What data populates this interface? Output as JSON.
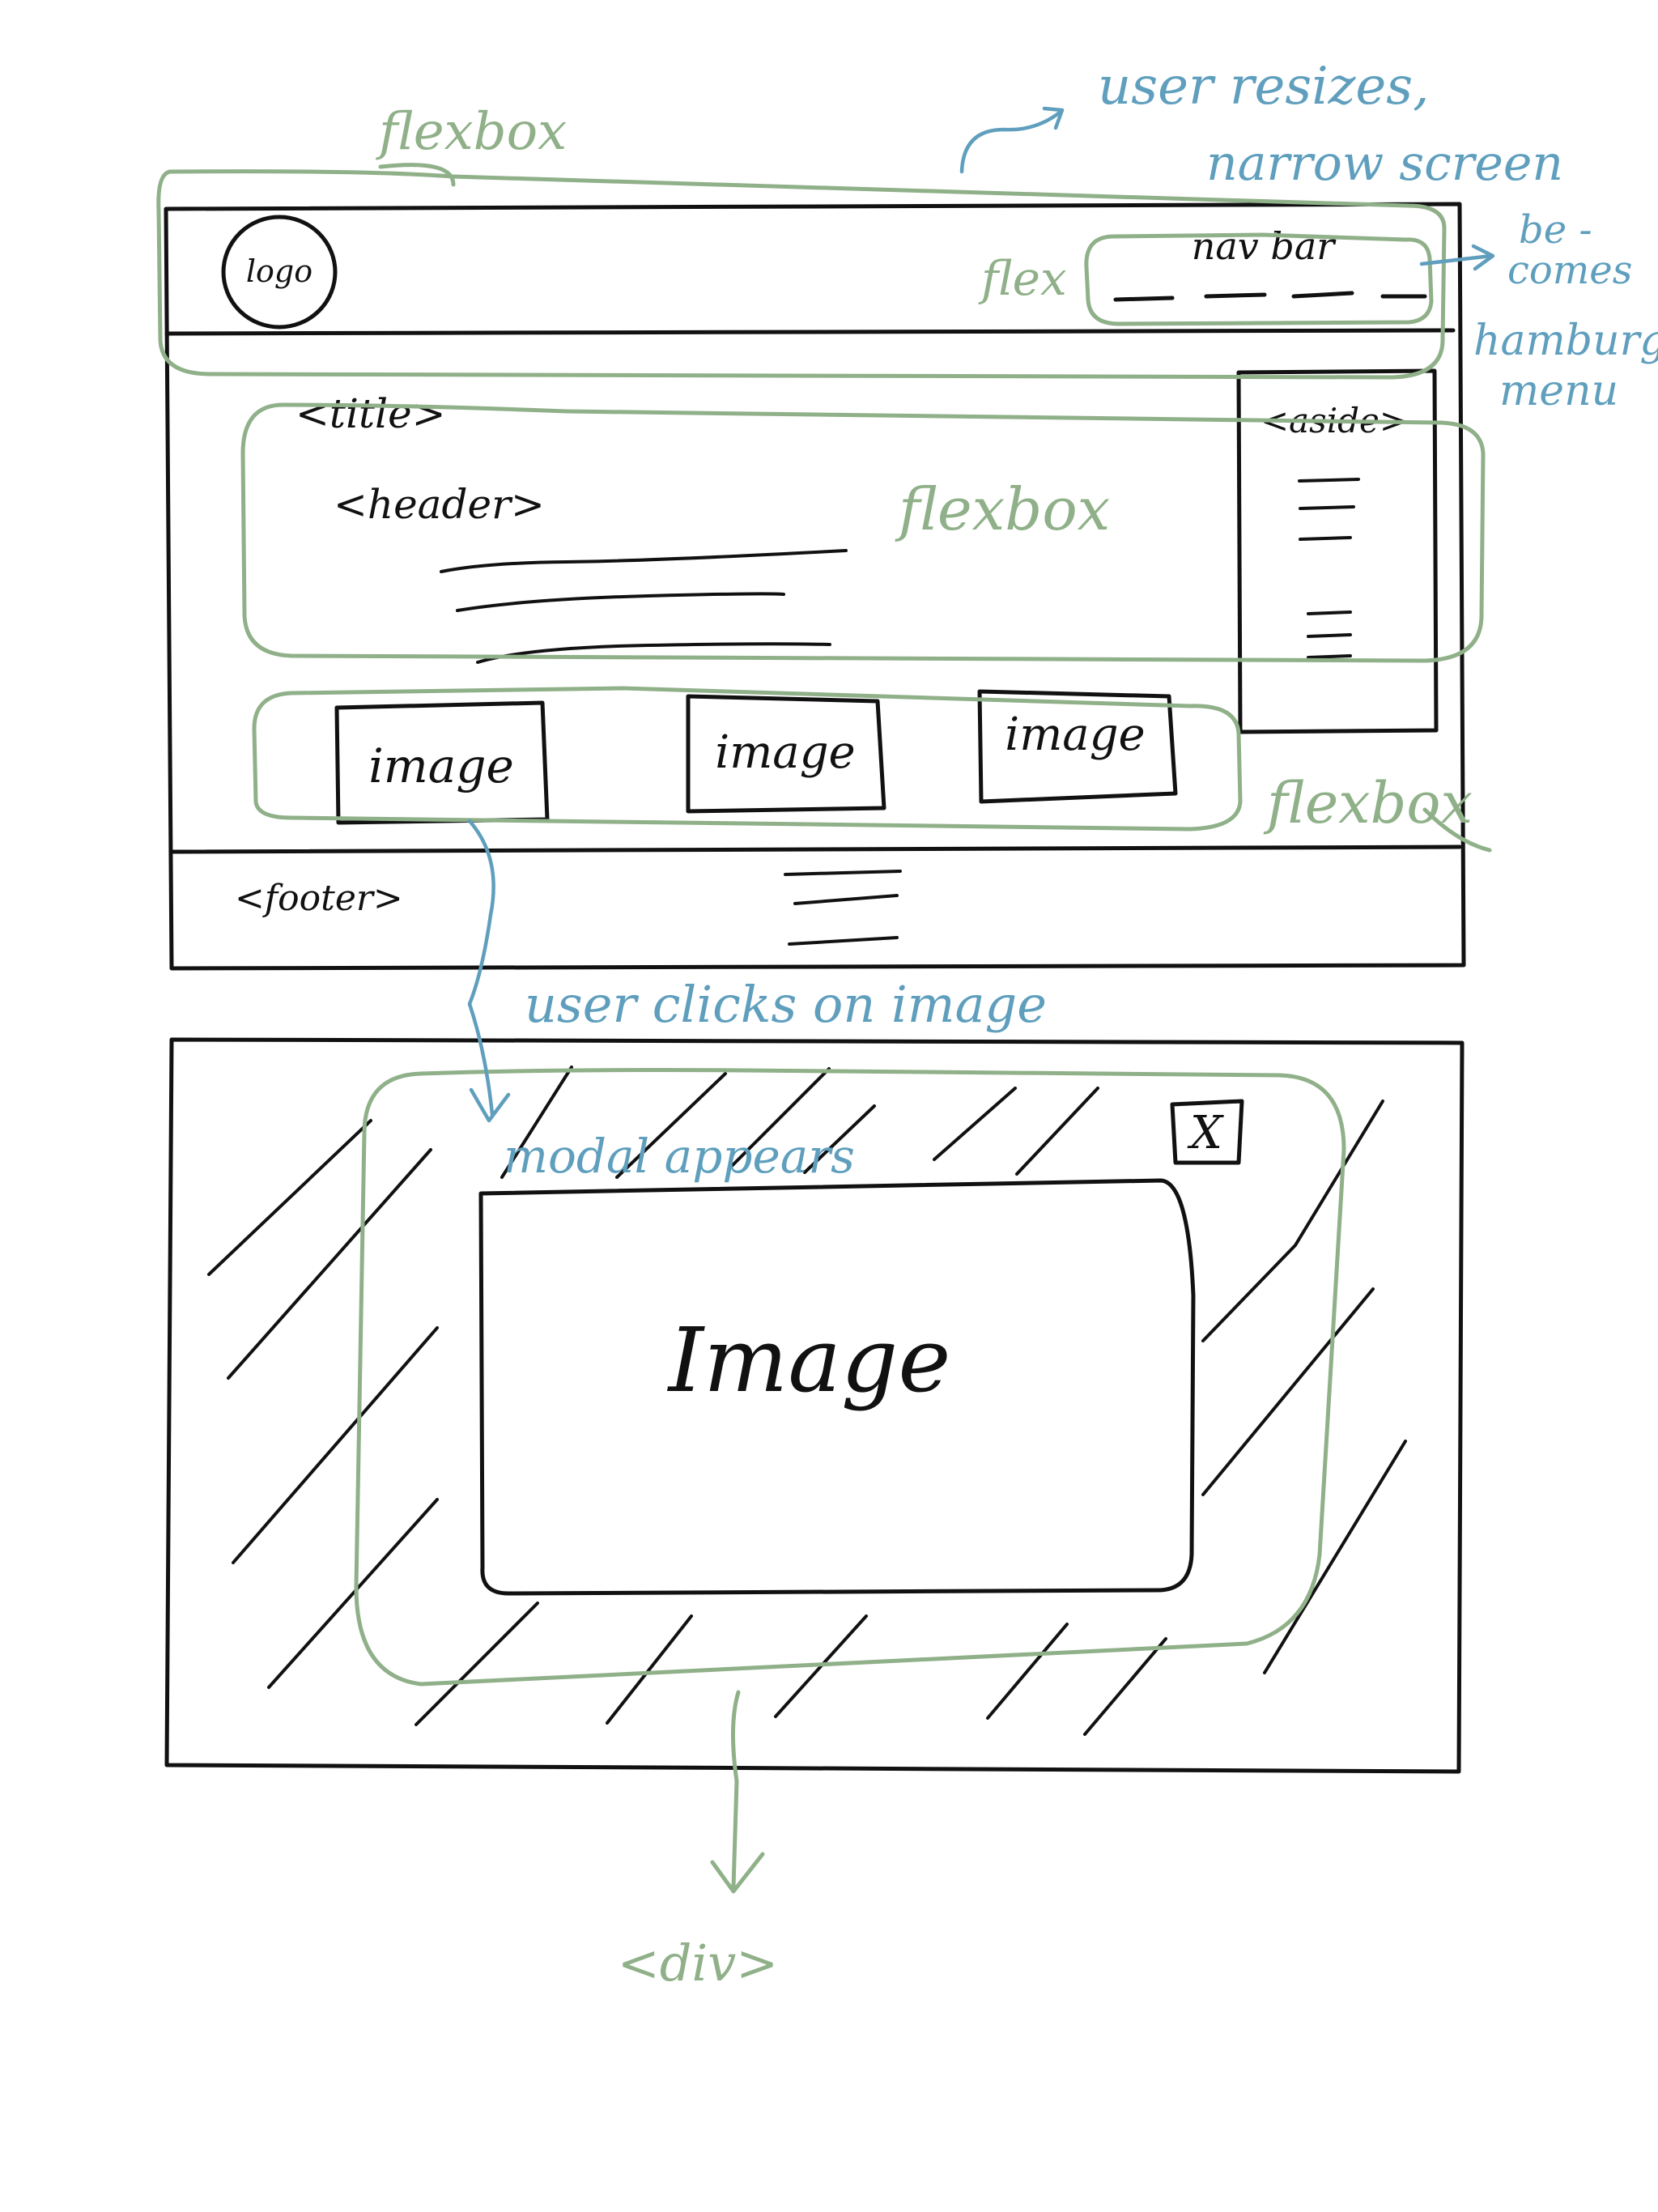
{
  "colors": {
    "ink": "#111111",
    "green": "#8fb088",
    "blue": "#5f9fbd"
  },
  "top_wireframe": {
    "logo": "logo",
    "navbar": "nav bar",
    "title": "<title>",
    "header": "<header>",
    "aside": "<aside>",
    "images": [
      "image",
      "image",
      "image"
    ],
    "footer": "<footer>"
  },
  "bottom_wireframe": {
    "image": "Image",
    "close": "X"
  },
  "annotations": {
    "flexbox_nav": "flexbox",
    "flex_navbar": "flex",
    "flexbox_header": "flexbox",
    "flexbox_images": "flexbox",
    "resize_line1": "user resizes,",
    "resize_line2": "narrow screen",
    "becomes_line1": "be -",
    "becomes_line2": "comes",
    "hamburger_line1": "hamburger",
    "hamburger_line2": "menu",
    "user_clicks": "user clicks on image",
    "modal_appears": "modal appears",
    "div": "<div>"
  }
}
